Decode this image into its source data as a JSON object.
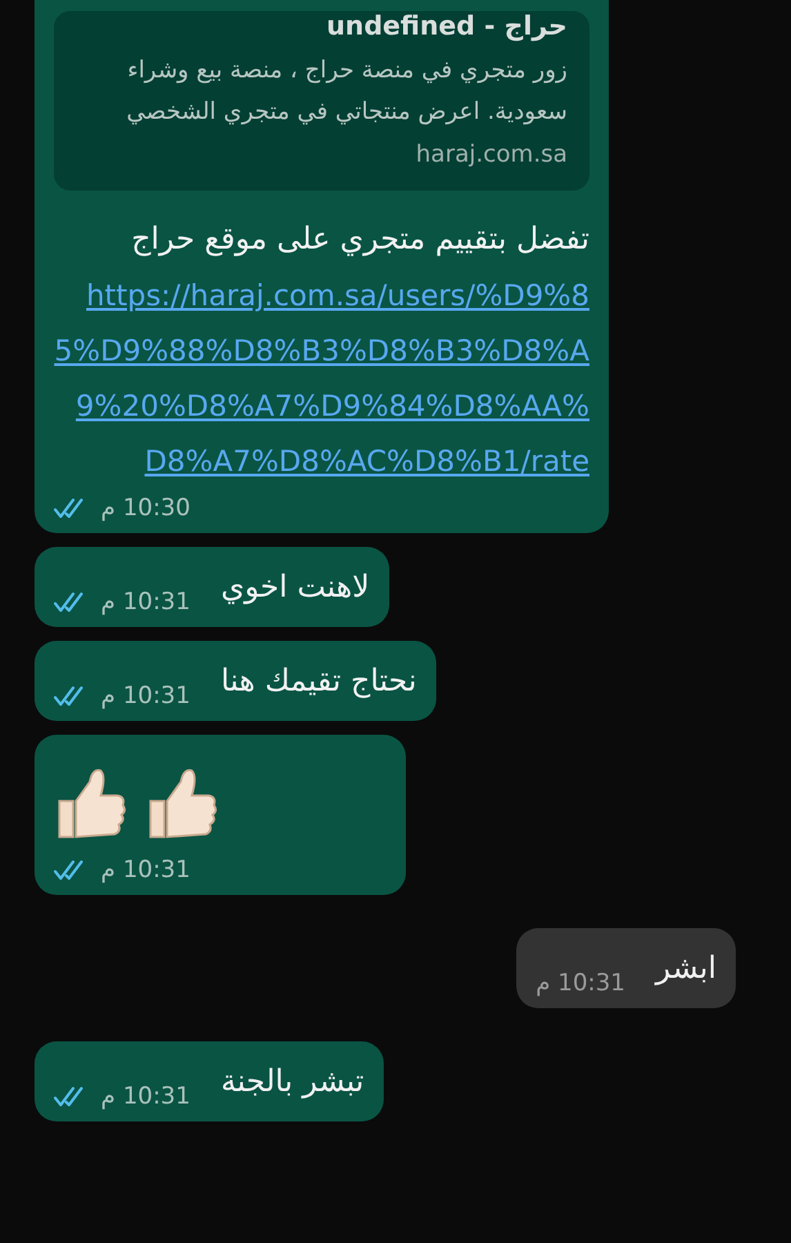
{
  "messages": [
    {
      "kind": "sent_link",
      "read": true,
      "preview": {
        "title": "undefined - حراج",
        "description": "زور متجري في منصة حراج ، منصة بيع وشراء سعودية. اعرض منتجاتي في متجري الشخصي",
        "domain": "haraj.com.sa"
      },
      "text": "تفضل بتقييم متجري على موقع حراج",
      "link": "https://haraj.com.sa/users/%D9%85%D9%88%D8%B3%D8%B3%D8%A9%20%D8%A7%D9%84%D8%AA%D8%A7%D8%AC%D8%B1/rate",
      "time": "10:30 م"
    },
    {
      "kind": "sent_text",
      "read": true,
      "text": "لاهنت اخوي",
      "time": "10:31 م"
    },
    {
      "kind": "sent_text",
      "read": true,
      "text": "نحتاج تقيمك هنا",
      "time": "10:31 م"
    },
    {
      "kind": "sent_emoji",
      "read": true,
      "emoji": [
        {
          "kind": "thumbs_up"
        },
        {
          "kind": "thumbs_up"
        }
      ],
      "time": "10:31 م"
    },
    {
      "kind": "received_text",
      "text": "ابشر",
      "time": "10:31 م"
    },
    {
      "kind": "sent_text",
      "read": true,
      "text": "تبشر بالجنة",
      "time": "10:31 م"
    }
  ]
}
